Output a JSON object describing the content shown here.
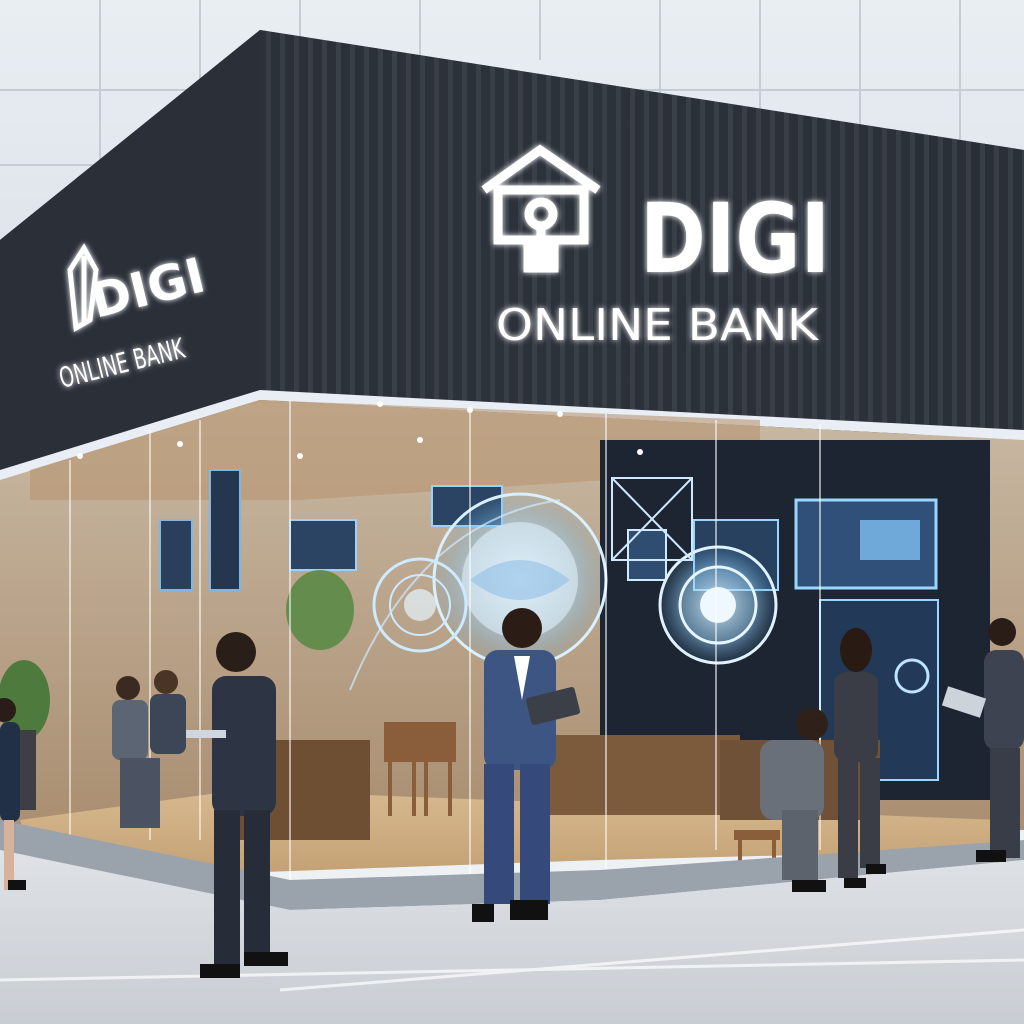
{
  "scene": {
    "description_free": true
  },
  "main_sign": {
    "brand": "DIGI",
    "subtitle": "ONLINE BANK"
  },
  "side_sign": {
    "brand": "DIGI",
    "subtitle": "ONLINE BANK"
  },
  "colors": {
    "facade": "#2b3039",
    "sign_glow": "#ffffff",
    "holo_blue": "#8fd0ff",
    "wood": "#b58a5e",
    "sidewalk": "#d9dde2",
    "suit_navy": "#2c3a5c"
  }
}
